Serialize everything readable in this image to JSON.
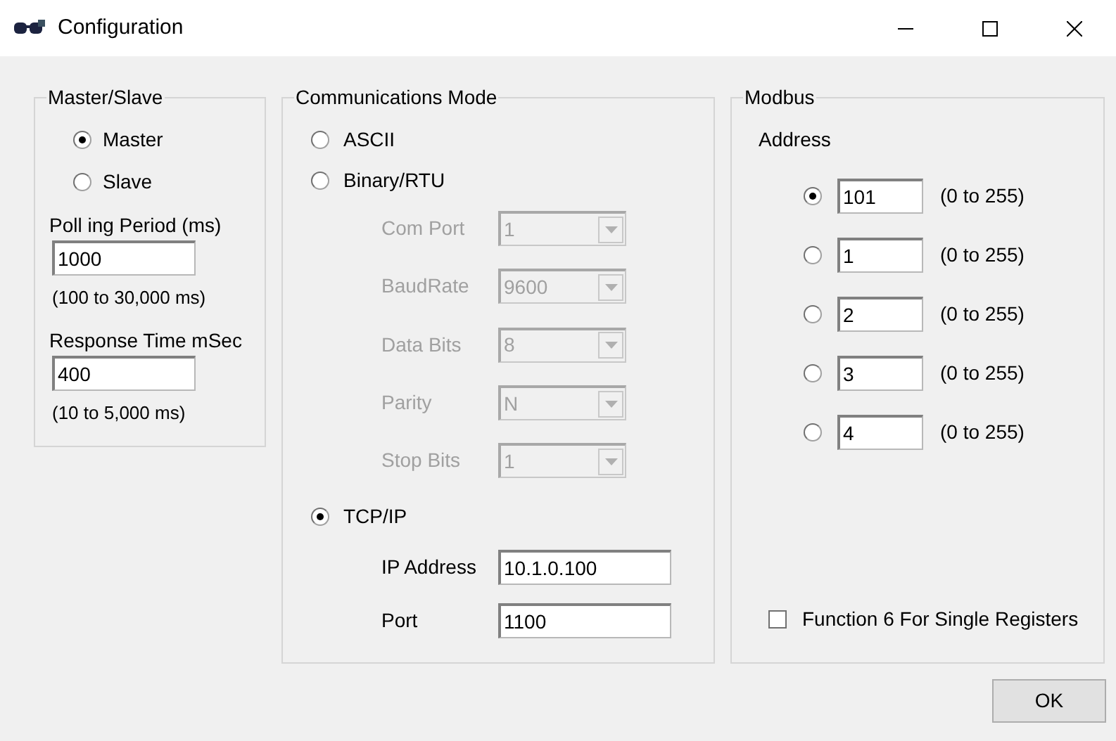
{
  "window": {
    "title": "Configuration"
  },
  "master_slave": {
    "title": "Master/Slave",
    "roles": [
      {
        "label": "Master",
        "selected": true
      },
      {
        "label": "Slave",
        "selected": false
      }
    ],
    "polling_period": {
      "label": "Poll ing Period (ms)",
      "value": "1000",
      "range": "(100 to 30,000 ms)"
    },
    "response_time": {
      "label": "Response Time mSec",
      "value": "400",
      "range": "(10 to 5,000 ms)"
    }
  },
  "communications_mode": {
    "title": "Communications Mode",
    "modes": [
      {
        "label": "ASCII",
        "selected": false
      },
      {
        "label": "Binary/RTU",
        "selected": false
      },
      {
        "label": "TCP/IP",
        "selected": true
      }
    ],
    "serial_settings": [
      {
        "label": "Com Port",
        "value": "1",
        "disabled": true
      },
      {
        "label": "BaudRate",
        "value": "9600",
        "disabled": true
      },
      {
        "label": "Data Bits",
        "value": "8",
        "disabled": true
      },
      {
        "label": "Parity",
        "value": "N",
        "disabled": true
      },
      {
        "label": "Stop Bits",
        "value": "1",
        "disabled": true
      }
    ],
    "tcp_fields": [
      {
        "label": "IP Address",
        "value": "10.1.0.100"
      },
      {
        "label": "Port",
        "value": "1100"
      }
    ]
  },
  "modbus": {
    "title": "Modbus",
    "address_label": "Address",
    "addresses": [
      {
        "value": "101",
        "range": "(0 to 255)",
        "selected": true
      },
      {
        "value": "1",
        "range": "(0 to 255)",
        "selected": false
      },
      {
        "value": "2",
        "range": "(0 to 255)",
        "selected": false
      },
      {
        "value": "3",
        "range": "(0 to 255)",
        "selected": false
      },
      {
        "value": "4",
        "range": "(0 to 255)",
        "selected": false
      }
    ],
    "function6": {
      "label": "Function 6 For Single Registers",
      "checked": false
    }
  },
  "buttons": [
    {
      "label": "OK"
    }
  ]
}
